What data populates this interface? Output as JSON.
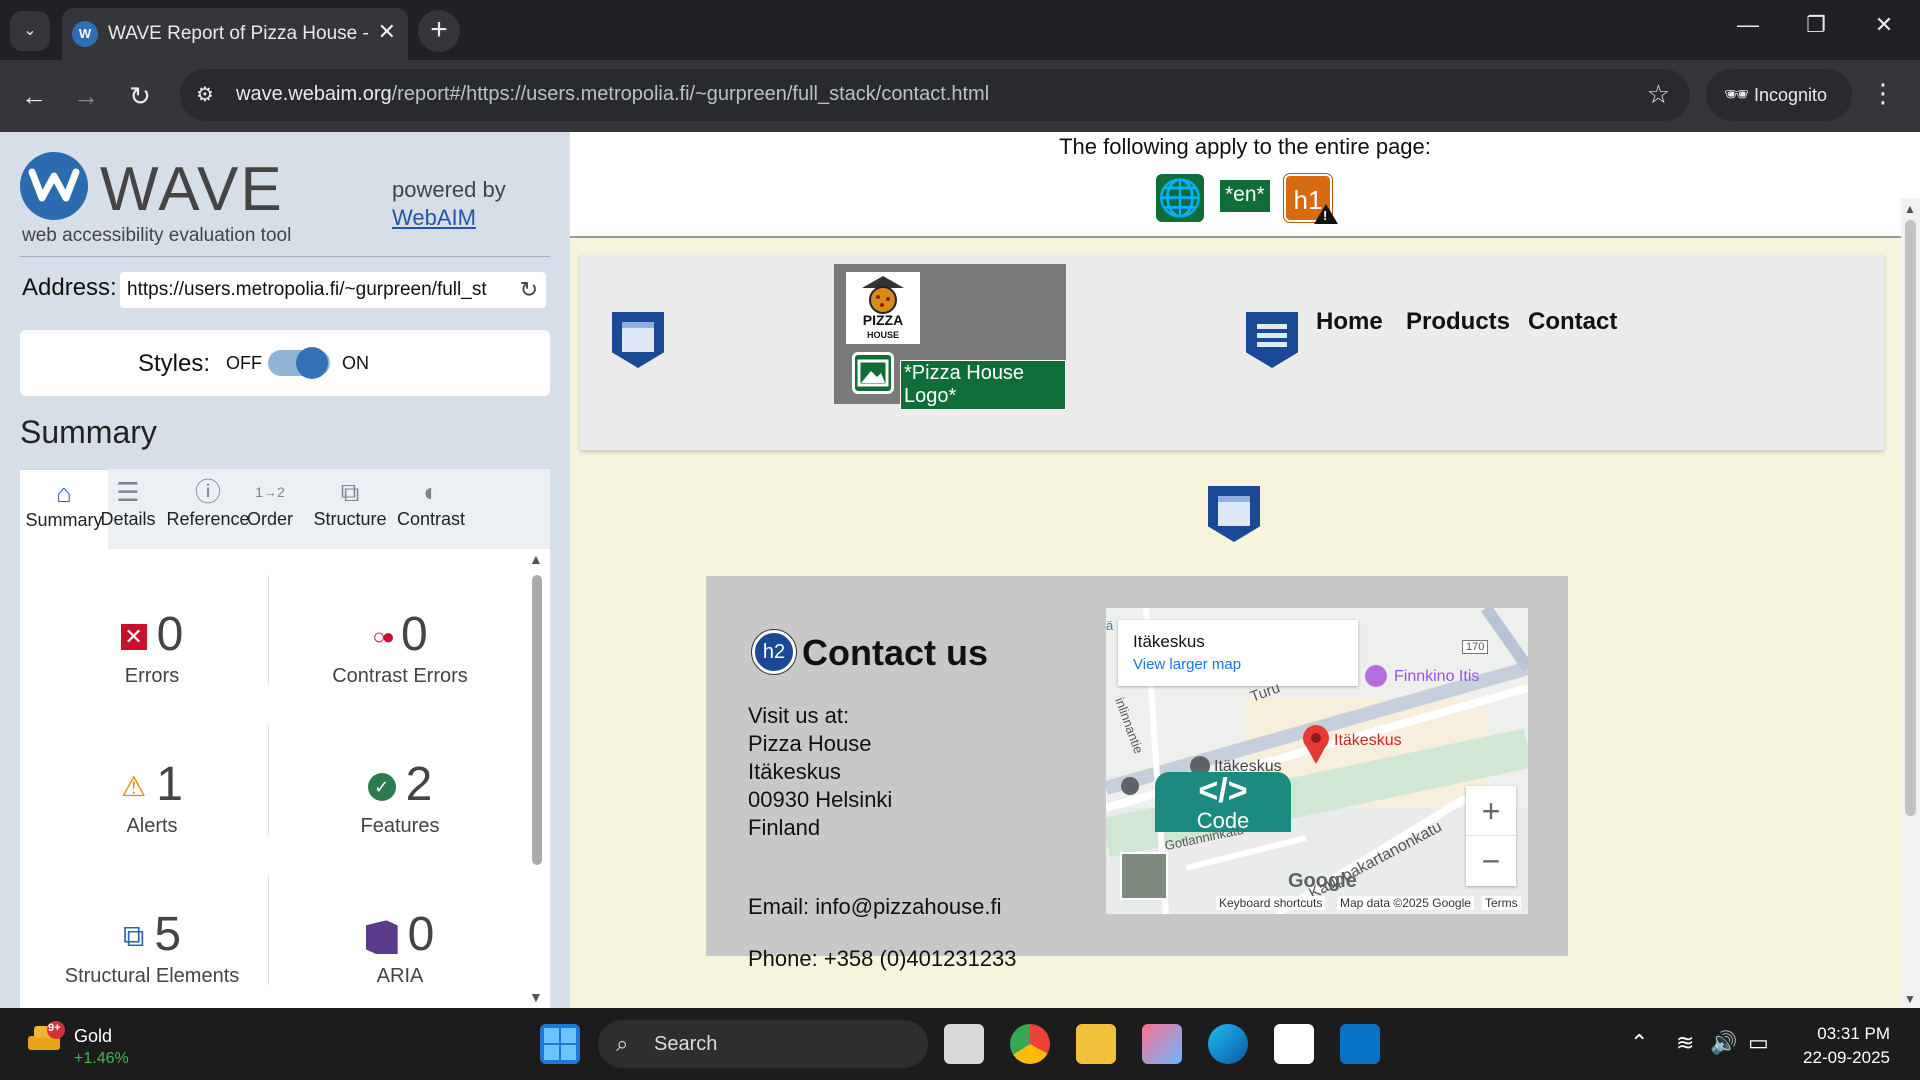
{
  "browser": {
    "tab_title": "WAVE Report of Pizza House - C",
    "url_host": "wave.webaim.org",
    "url_path": "/report#/https://users.metropolia.fi/~gurpreen/full_stack/contact.html",
    "incognito_label": "Incognito"
  },
  "wave": {
    "brand": "WAVE",
    "tagline": "web accessibility evaluation tool",
    "powered_by": "powered by",
    "webaim_link": "WebAIM",
    "address_label": "Address:",
    "address_value": "https://users.metropolia.fi/~gurpreen/full_st",
    "styles_label": "Styles:",
    "styles_off": "OFF",
    "styles_on": "ON",
    "styles_enabled": true,
    "summary_heading": "Summary",
    "tabs": [
      "Summary",
      "Details",
      "Reference",
      "Order",
      "Structure",
      "Contrast"
    ],
    "active_tab": "Summary",
    "counts": {
      "errors": {
        "value": "0",
        "label": "Errors"
      },
      "contrast_errors": {
        "value": "0",
        "label": "Contrast Errors"
      },
      "alerts": {
        "value": "1",
        "label": "Alerts"
      },
      "features": {
        "value": "2",
        "label": "Features"
      },
      "structural": {
        "value": "5",
        "label": "Structural Elements"
      },
      "aria": {
        "value": "0",
        "label": "ARIA"
      }
    }
  },
  "page": {
    "applies_text": "The following apply to the entire page:",
    "lang_badge": "*en*",
    "h1_badge": "h1",
    "logo_text": "PIZZA",
    "logo_subtext": "HOUSE",
    "logo_alt": "*Pizza House Logo*",
    "nav": [
      "Home",
      "Products",
      "Contact"
    ],
    "h2_badge": "h2",
    "contact_heading": "Contact us",
    "address_lines": [
      "Visit us at:",
      "Pizza House",
      "Itäkeskus",
      "00930 Helsinki",
      "Finland"
    ],
    "email": "Email: info@pizzahouse.fi",
    "phone": "Phone: +358 (0)401231233",
    "code_label": "Code",
    "map": {
      "place": "Itäkeskus",
      "larger_link": "View larger map",
      "labels": [
        "Finnkino Itis",
        "Itäkeskus",
        "Itäkeskus",
        "Turu",
        "Gotlanninkatu",
        "Kauppakartanonkatu",
        "170",
        "ä",
        "inlinnantie"
      ],
      "footer": [
        "Keyboard shortcuts",
        "Map data ©2025 Google",
        "Terms"
      ],
      "google": "Google"
    }
  },
  "taskbar": {
    "stock_name": "Gold",
    "stock_change": "+1.46%",
    "badge": "9+",
    "search": "Search",
    "time": "03:31 PM",
    "date": "22-09-2025"
  }
}
